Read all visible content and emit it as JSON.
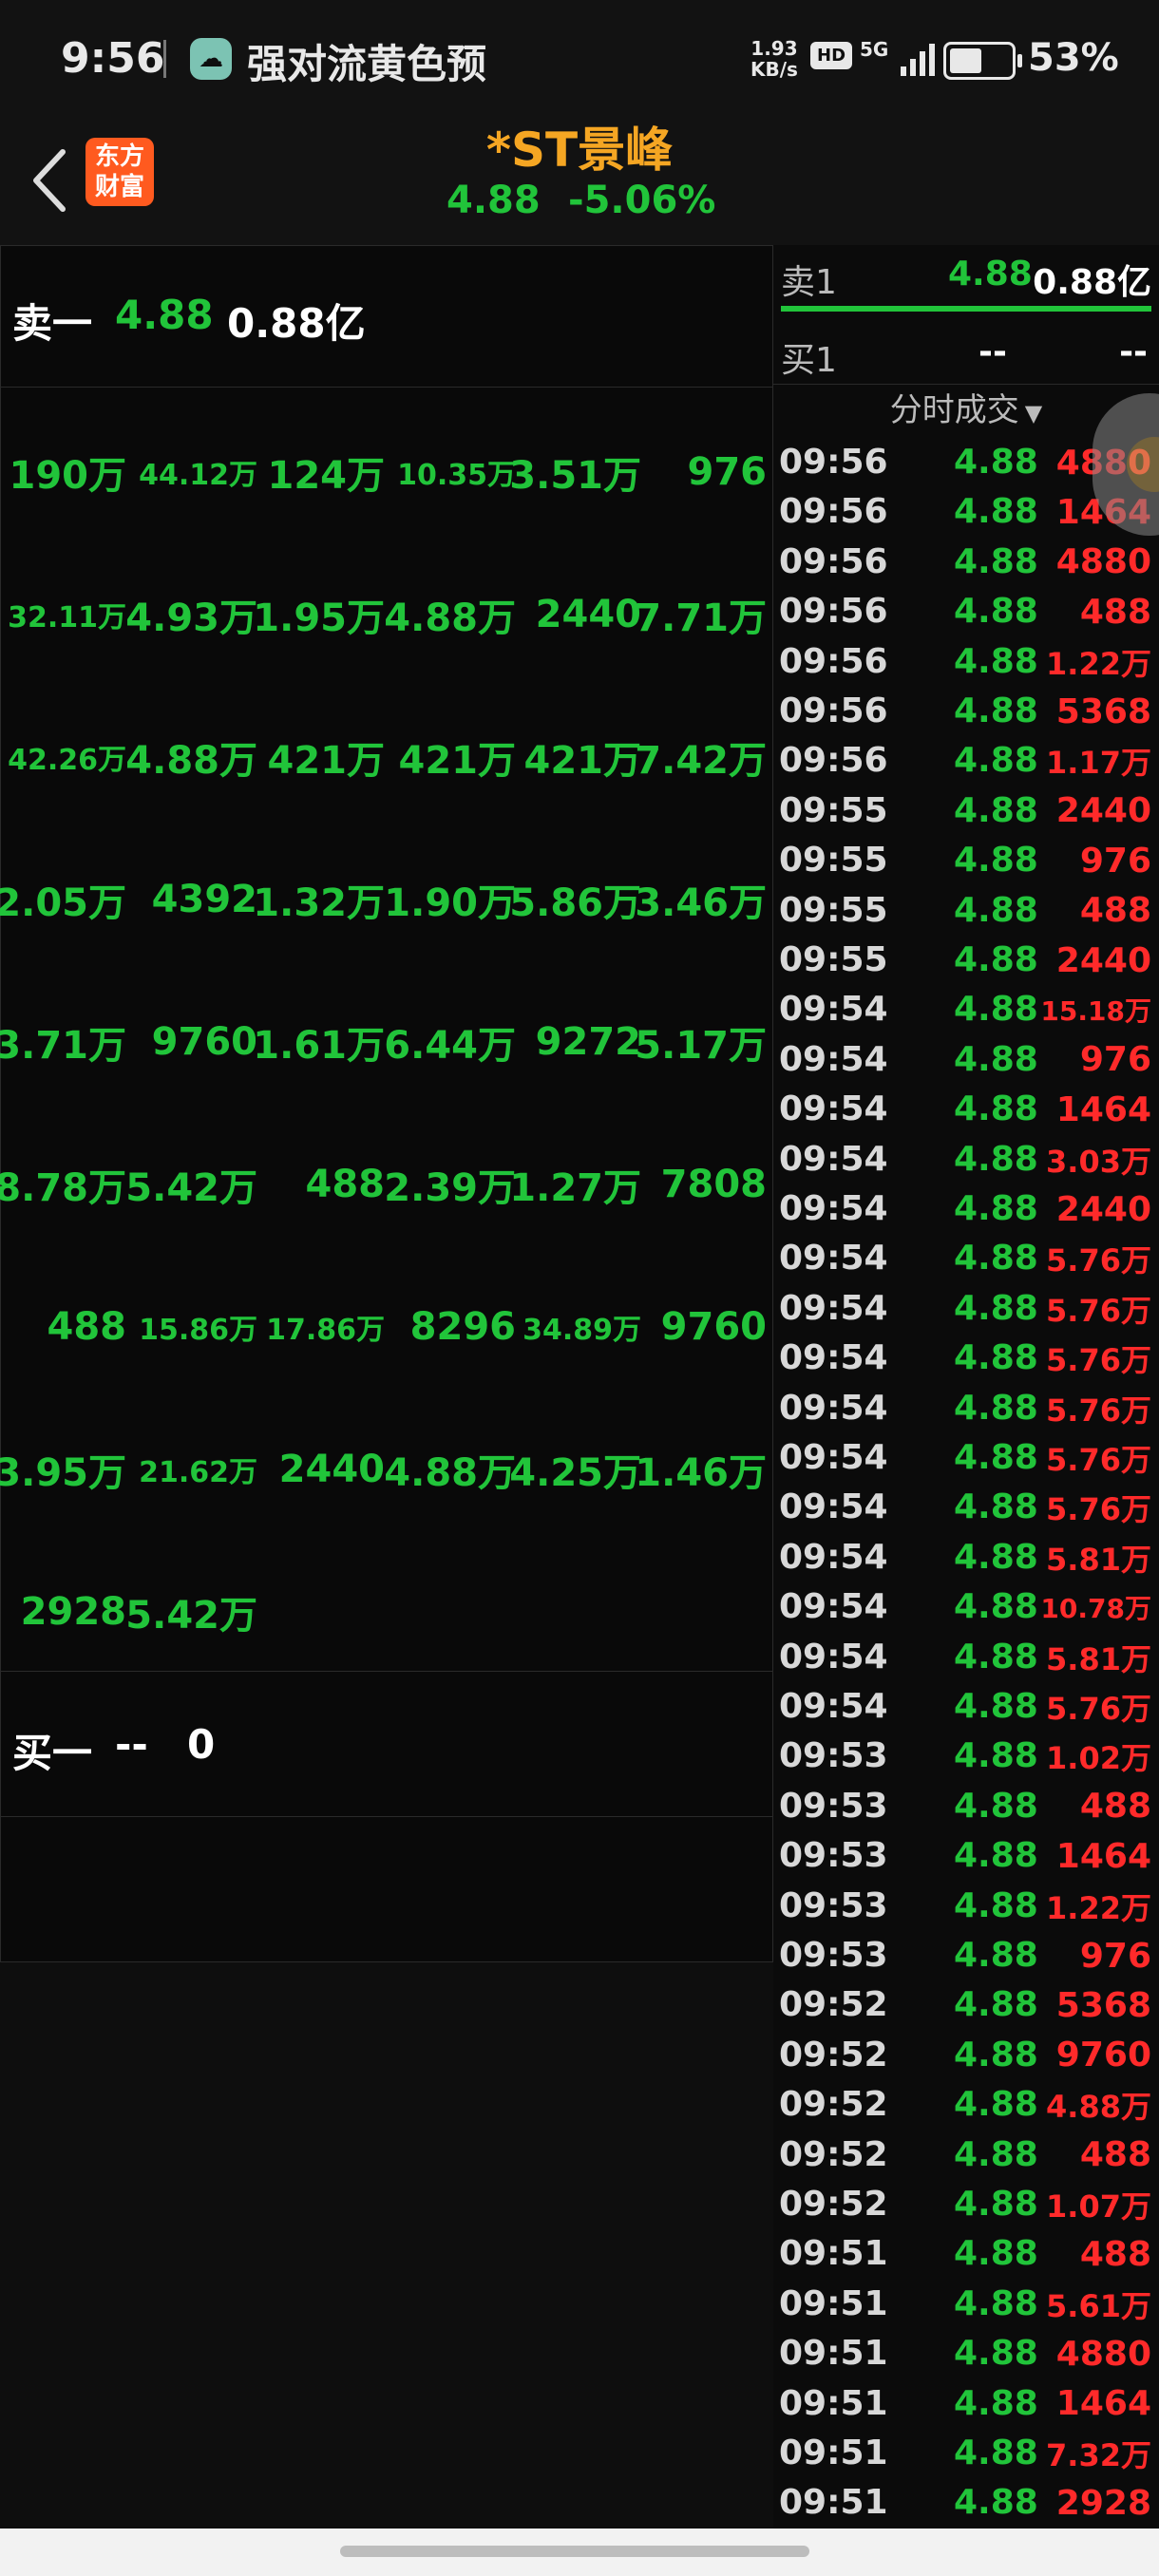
{
  "status_bar": {
    "time": "9:56",
    "notification": "强对流黄色预",
    "net_speed_value": "1.93",
    "net_speed_unit": "KB/s",
    "hd": "HD",
    "signal": "5G",
    "battery_pct": "53%",
    "battery_level": 0.53
  },
  "header": {
    "back_icon": "chevron-left-icon",
    "logo_text_line1": "东方",
    "logo_text_line2": "财富",
    "stock_name": "*ST景峰",
    "price": "4.88",
    "change_pct": "-5.06%"
  },
  "order_book": {
    "sell1_label": "卖一",
    "sell1_price": "4.88",
    "sell1_volume": "0.88亿",
    "queue": [
      [
        "190万",
        "44.12万",
        "124万",
        "10.35万",
        "3.51万",
        "976"
      ],
      [
        "32.11万",
        "4.93万",
        "1.95万",
        "4.88万",
        "2440",
        "7.71万"
      ],
      [
        "42.26万",
        "4.88万",
        "421万",
        "421万",
        "421万",
        "7.42万"
      ],
      [
        "2.05万",
        "4392",
        "1.32万",
        "1.90万",
        "5.86万",
        "3.46万"
      ],
      [
        "3.71万",
        "9760",
        "1.61万",
        "6.44万",
        "9272",
        "5.17万"
      ],
      [
        "8.78万",
        "5.42万",
        "488",
        "2.39万",
        "1.27万",
        "7808"
      ],
      [
        "488",
        "15.86万",
        "17.86万",
        "8296",
        "34.89万",
        "9760"
      ],
      [
        "3.95万",
        "21.62万",
        "2440",
        "4.88万",
        "4.25万",
        "1.46万"
      ],
      [
        "2928",
        "5.42万"
      ]
    ],
    "buy1_label": "买一",
    "buy1_price": "--",
    "buy1_volume": "0"
  },
  "side_panel": {
    "ask1_label": "卖1",
    "ask1_price": "4.88",
    "ask1_volume": "0.88亿",
    "bid1_label": "买1",
    "bid1_price": "--",
    "bid1_volume": "--",
    "tick_title": "分时成交",
    "trades": [
      {
        "time": "09:56",
        "price": "4.88",
        "vol": "4880"
      },
      {
        "time": "09:56",
        "price": "4.88",
        "vol": "1464"
      },
      {
        "time": "09:56",
        "price": "4.88",
        "vol": "4880"
      },
      {
        "time": "09:56",
        "price": "4.88",
        "vol": "488"
      },
      {
        "time": "09:56",
        "price": "4.88",
        "vol": "1.22万"
      },
      {
        "time": "09:56",
        "price": "4.88",
        "vol": "5368"
      },
      {
        "time": "09:56",
        "price": "4.88",
        "vol": "1.17万"
      },
      {
        "time": "09:55",
        "price": "4.88",
        "vol": "2440"
      },
      {
        "time": "09:55",
        "price": "4.88",
        "vol": "976"
      },
      {
        "time": "09:55",
        "price": "4.88",
        "vol": "488"
      },
      {
        "time": "09:55",
        "price": "4.88",
        "vol": "2440"
      },
      {
        "time": "09:54",
        "price": "4.88",
        "vol": "15.18万"
      },
      {
        "time": "09:54",
        "price": "4.88",
        "vol": "976"
      },
      {
        "time": "09:54",
        "price": "4.88",
        "vol": "1464"
      },
      {
        "time": "09:54",
        "price": "4.88",
        "vol": "3.03万"
      },
      {
        "time": "09:54",
        "price": "4.88",
        "vol": "2440"
      },
      {
        "time": "09:54",
        "price": "4.88",
        "vol": "5.76万"
      },
      {
        "time": "09:54",
        "price": "4.88",
        "vol": "5.76万"
      },
      {
        "time": "09:54",
        "price": "4.88",
        "vol": "5.76万"
      },
      {
        "time": "09:54",
        "price": "4.88",
        "vol": "5.76万"
      },
      {
        "time": "09:54",
        "price": "4.88",
        "vol": "5.76万"
      },
      {
        "time": "09:54",
        "price": "4.88",
        "vol": "5.76万"
      },
      {
        "time": "09:54",
        "price": "4.88",
        "vol": "5.81万"
      },
      {
        "time": "09:54",
        "price": "4.88",
        "vol": "10.78万"
      },
      {
        "time": "09:54",
        "price": "4.88",
        "vol": "5.81万"
      },
      {
        "time": "09:54",
        "price": "4.88",
        "vol": "5.76万"
      },
      {
        "time": "09:53",
        "price": "4.88",
        "vol": "1.02万"
      },
      {
        "time": "09:53",
        "price": "4.88",
        "vol": "488"
      },
      {
        "time": "09:53",
        "price": "4.88",
        "vol": "1464"
      },
      {
        "time": "09:53",
        "price": "4.88",
        "vol": "1.22万"
      },
      {
        "time": "09:53",
        "price": "4.88",
        "vol": "976"
      },
      {
        "time": "09:52",
        "price": "4.88",
        "vol": "5368"
      },
      {
        "time": "09:52",
        "price": "4.88",
        "vol": "9760"
      },
      {
        "time": "09:52",
        "price": "4.88",
        "vol": "4.88万"
      },
      {
        "time": "09:52",
        "price": "4.88",
        "vol": "488"
      },
      {
        "time": "09:52",
        "price": "4.88",
        "vol": "1.07万"
      },
      {
        "time": "09:51",
        "price": "4.88",
        "vol": "488"
      },
      {
        "time": "09:51",
        "price": "4.88",
        "vol": "5.61万"
      },
      {
        "time": "09:51",
        "price": "4.88",
        "vol": "4880"
      },
      {
        "time": "09:51",
        "price": "4.88",
        "vol": "1464"
      },
      {
        "time": "09:51",
        "price": "4.88",
        "vol": "7.32万"
      },
      {
        "time": "09:51",
        "price": "4.88",
        "vol": "2928"
      }
    ]
  },
  "colors": {
    "up_green": "#21c43a",
    "down_red": "#ff2a2a",
    "accent_orange": "#f5a623",
    "brand_orange": "#ff5a1f"
  }
}
